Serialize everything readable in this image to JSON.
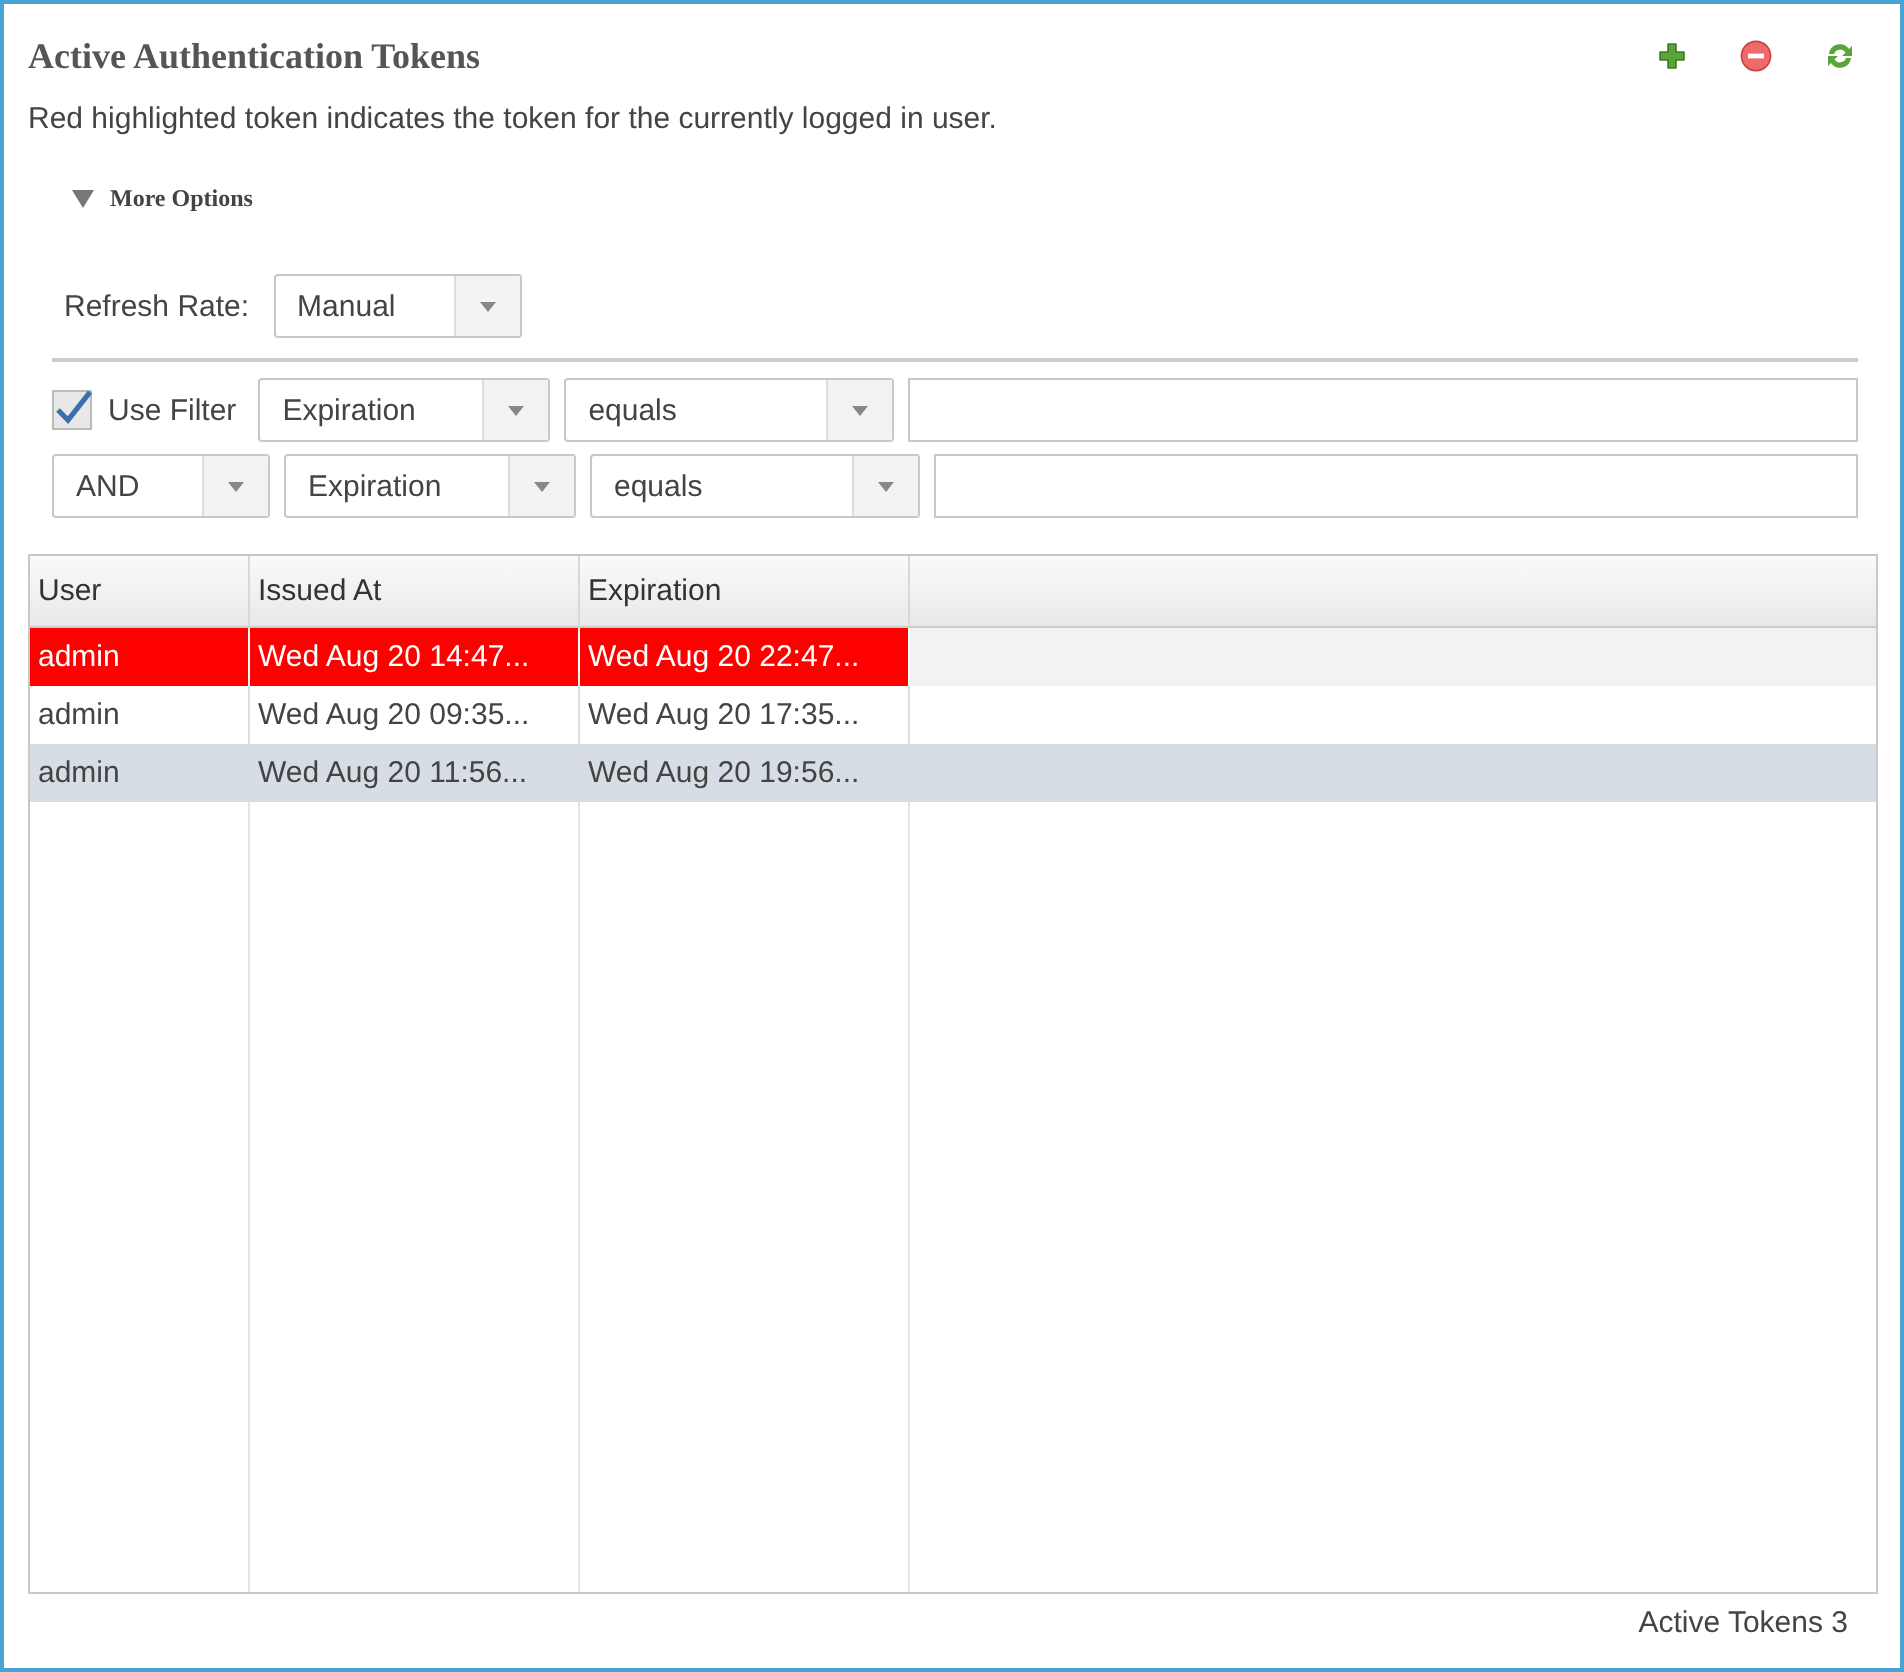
{
  "panel": {
    "title": "Active Authentication Tokens",
    "toolbar": [
      {
        "kind": "add"
      },
      {
        "kind": "remove"
      },
      {
        "kind": "refresh"
      }
    ]
  },
  "description": "Red highlighted token indicates the token for the currently logged in user.",
  "more_options": {
    "label": "More Options",
    "expanded": true
  },
  "refresh_rate": {
    "label": "Refresh Rate:",
    "value": "Manual"
  },
  "filters": [
    {
      "kind": "checkbox",
      "label": "Use Filter",
      "checked": true,
      "field": "Expiration",
      "operator": "equals"
    },
    {
      "kind": "conjunction",
      "value": "AND",
      "field": "Expiration",
      "operator": "equals"
    }
  ],
  "table": {
    "columns": [
      "User",
      "Issued At",
      "Expiration"
    ],
    "rows": [
      {
        "cells": [
          "admin",
          "Wed Aug 20 14:47...",
          "Wed Aug 20 22:47..."
        ],
        "current_user": true,
        "selected": false
      },
      {
        "cells": [
          "admin",
          "Wed Aug 20 09:35...",
          "Wed Aug 20 17:35..."
        ],
        "current_user": false,
        "selected": false
      },
      {
        "cells": [
          "admin",
          "Wed Aug 20 11:56...",
          "Wed Aug 20 19:56..."
        ],
        "current_user": false,
        "selected": true
      }
    ]
  },
  "status_bar": "Active Tokens 3"
}
